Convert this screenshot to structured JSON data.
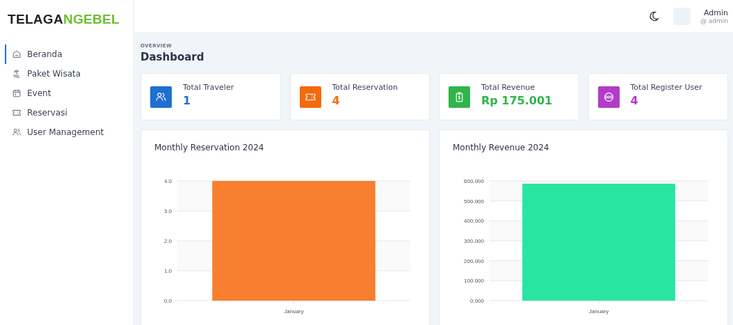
{
  "logo": {
    "parts": [
      {
        "text": "TELAGA",
        "color": "#222222"
      },
      {
        "text": "NGEBEL",
        "color": "#6cbf2e"
      }
    ]
  },
  "sidebar": {
    "items": [
      {
        "label": "Beranda",
        "selected": true
      },
      {
        "label": "Paket Wisata",
        "selected": false
      },
      {
        "label": "Event",
        "selected": false
      },
      {
        "label": "Reservasi",
        "selected": false
      },
      {
        "label": "User Management",
        "selected": false
      }
    ]
  },
  "header": {
    "user": {
      "name": "Admin",
      "handle": "@ admin"
    }
  },
  "page": {
    "eyebrow": "OVERVIEW",
    "title": "Dashboard"
  },
  "stats": [
    {
      "label": "Total Traveler",
      "value": "1",
      "color": "#1f6fd1"
    },
    {
      "label": "Total Reservation",
      "value": "4",
      "color": "#f5690f"
    },
    {
      "label": "Total Revenue",
      "value": "Rp 175.001",
      "color": "#2fb54a"
    },
    {
      "label": "Total Register User",
      "value": "4",
      "color": "#b23cc8"
    }
  ],
  "charts": [
    {
      "chart_data": {
        "type": "bar",
        "title": "Monthly Reservation 2024",
        "categories": [
          "January"
        ],
        "series": [
          {
            "color": "#f77f2f",
            "values": [
              4
            ]
          }
        ],
        "ylim": [
          0,
          4
        ],
        "grid": true,
        "yticks": [
          {
            "value": 0,
            "label": "0.0"
          },
          {
            "value": 1,
            "label": "1.0"
          },
          {
            "value": 2,
            "label": "2.0"
          },
          {
            "value": 3,
            "label": "3.0"
          },
          {
            "value": 4,
            "label": "4.0"
          }
        ]
      }
    },
    {
      "chart_data": {
        "type": "bar",
        "title": "Monthly Revenue 2024",
        "categories": [
          "January"
        ],
        "series": [
          {
            "color": "#29e5a2",
            "values": [
              586
            ]
          }
        ],
        "ylim": [
          0,
          600
        ],
        "grid": true,
        "yticks": [
          {
            "value": 0,
            "label": "0.000"
          },
          {
            "value": 100,
            "label": "100.000"
          },
          {
            "value": 200,
            "label": "200.000"
          },
          {
            "value": 300,
            "label": "300.000"
          },
          {
            "value": 400,
            "label": "400.000"
          },
          {
            "value": 500,
            "label": "500.000"
          },
          {
            "value": 600,
            "label": "600.000"
          }
        ]
      }
    }
  ]
}
